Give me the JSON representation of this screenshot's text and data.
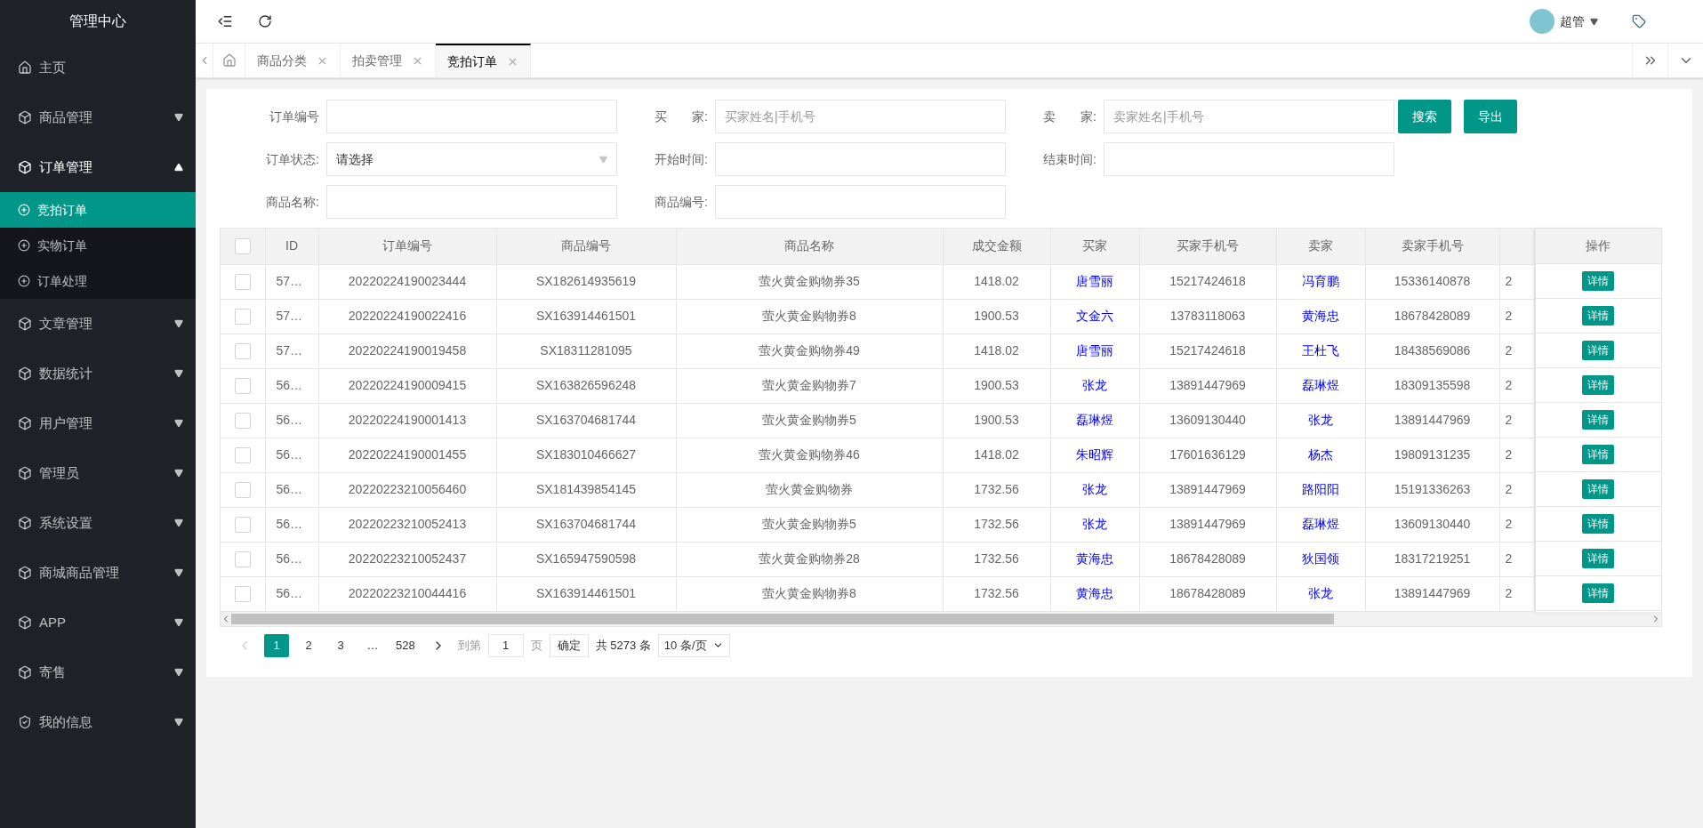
{
  "sidebar": {
    "title": "管理中心",
    "items": [
      {
        "label": "主页"
      },
      {
        "label": "商品管理",
        "expanded": false
      },
      {
        "label": "订单管理",
        "expanded": true,
        "children": [
          {
            "label": "竞拍订单",
            "selected": true
          },
          {
            "label": "实物订单",
            "selected": false
          },
          {
            "label": "订单处理",
            "selected": false
          }
        ]
      },
      {
        "label": "文章管理",
        "expanded": false
      },
      {
        "label": "数据统计",
        "expanded": false
      },
      {
        "label": "用户管理",
        "expanded": false
      },
      {
        "label": "管理员",
        "expanded": false
      },
      {
        "label": "系统设置",
        "expanded": false
      },
      {
        "label": "商城商品管理",
        "expanded": false
      },
      {
        "label": "APP",
        "expanded": false
      },
      {
        "label": "寄售",
        "expanded": false
      },
      {
        "label": "我的信息",
        "expanded": false
      }
    ]
  },
  "header": {
    "user": "超管"
  },
  "tabs": [
    {
      "label": "商品分类",
      "selected": false
    },
    {
      "label": "拍卖管理",
      "selected": false
    },
    {
      "label": "竞拍订单",
      "selected": true
    }
  ],
  "filters": [
    {
      "label": "订单编号",
      "kind": "text"
    },
    {
      "label": "买　　家:",
      "kind": "text",
      "placeholder": "买家姓名|手机号"
    },
    {
      "label": "卖　　家:",
      "kind": "text",
      "placeholder": "卖家姓名|手机号"
    },
    {
      "label": "订单状态:",
      "kind": "select",
      "value": "请选择"
    },
    {
      "label": "开始时间:",
      "kind": "text"
    },
    {
      "label": "结束时间:",
      "kind": "text"
    },
    {
      "label": "商品名称:",
      "kind": "text"
    },
    {
      "label": "商品编号:",
      "kind": "text"
    }
  ],
  "buttons": [
    "搜索",
    "导出"
  ],
  "table": {
    "columns": [
      {
        "label": "ID",
        "kind": "text"
      },
      {
        "label": "订单编号",
        "kind": "text"
      },
      {
        "label": "商品编号",
        "kind": "text"
      },
      {
        "label": "商品名称",
        "kind": "text"
      },
      {
        "label": "成交金额",
        "kind": "text"
      },
      {
        "label": "买家",
        "kind": "link"
      },
      {
        "label": "买家手机号",
        "kind": "text"
      },
      {
        "label": "卖家",
        "kind": "link"
      },
      {
        "label": "卖家手机号",
        "kind": "text"
      },
      {
        "kind": "text"
      }
    ],
    "action_column": "操作",
    "all_checked": false,
    "rows": [
      {
        "checked": false,
        "cells": [
          "57…",
          "20220224190023444",
          "SX182614935619",
          "萤火黄金购物券35",
          "1418.02",
          "唐雪丽",
          "15217424618",
          "冯育鹏",
          "15336140878",
          "2"
        ],
        "action": "详情"
      },
      {
        "checked": false,
        "cells": [
          "57…",
          "20220224190022416",
          "SX163914461501",
          "萤火黄金购物券8",
          "1900.53",
          "文金六",
          "13783118063",
          "黄海忠",
          "18678428089",
          "2"
        ],
        "action": "详情"
      },
      {
        "checked": false,
        "cells": [
          "57…",
          "20220224190019458",
          "SX18311281095",
          "萤火黄金购物券49",
          "1418.02",
          "唐雪丽",
          "15217424618",
          "王杜飞",
          "18438569086",
          "2"
        ],
        "action": "详情"
      },
      {
        "checked": false,
        "cells": [
          "56…",
          "20220224190009415",
          "SX163826596248",
          "萤火黄金购物券7",
          "1900.53",
          "张龙",
          "13891447969",
          "磊琳煜",
          "18309135598",
          "2"
        ],
        "action": "详情"
      },
      {
        "checked": false,
        "cells": [
          "56…",
          "20220224190001413",
          "SX163704681744",
          "萤火黄金购物券5",
          "1900.53",
          "磊琳煜",
          "13609130440",
          "张龙",
          "13891447969",
          "2"
        ],
        "action": "详情"
      },
      {
        "checked": false,
        "cells": [
          "56…",
          "20220224190001455",
          "SX183010466627",
          "萤火黄金购物券46",
          "1418.02",
          "朱昭辉",
          "17601636129",
          "杨杰",
          "19809131235",
          "2"
        ],
        "action": "详情"
      },
      {
        "checked": false,
        "cells": [
          "56…",
          "20220223210056460",
          "SX181439854145",
          "萤火黄金购物券",
          "1732.56",
          "张龙",
          "13891447969",
          "路阳阳",
          "15191336263",
          "2"
        ],
        "action": "详情"
      },
      {
        "checked": false,
        "cells": [
          "56…",
          "20220223210052413",
          "SX163704681744",
          "萤火黄金购物券5",
          "1732.56",
          "张龙",
          "13891447969",
          "磊琳煜",
          "13609130440",
          "2"
        ],
        "action": "详情"
      },
      {
        "checked": false,
        "cells": [
          "56…",
          "20220223210052437",
          "SX165947590598",
          "萤火黄金购物券28",
          "1732.56",
          "黄海忠",
          "18678428089",
          "狄国领",
          "18317219251",
          "2"
        ],
        "action": "详情"
      },
      {
        "checked": false,
        "cells": [
          "56…",
          "20220223210044416",
          "SX163914461501",
          "萤火黄金购物券8",
          "1732.56",
          "黄海忠",
          "18678428089",
          "张龙",
          "13891447969",
          "2"
        ],
        "action": "详情"
      }
    ]
  },
  "pagination": {
    "pages": [
      {
        "label": "1",
        "selected": true
      },
      {
        "label": "2",
        "selected": false
      },
      {
        "label": "3",
        "selected": false
      },
      {
        "label": "…",
        "selected": false
      },
      {
        "label": "528",
        "selected": false
      }
    ],
    "goto_label": "到第",
    "goto_value": "1",
    "page_unit": "页",
    "confirm": "确定",
    "total": "共 5273 条",
    "page_size": "10 条/页"
  }
}
